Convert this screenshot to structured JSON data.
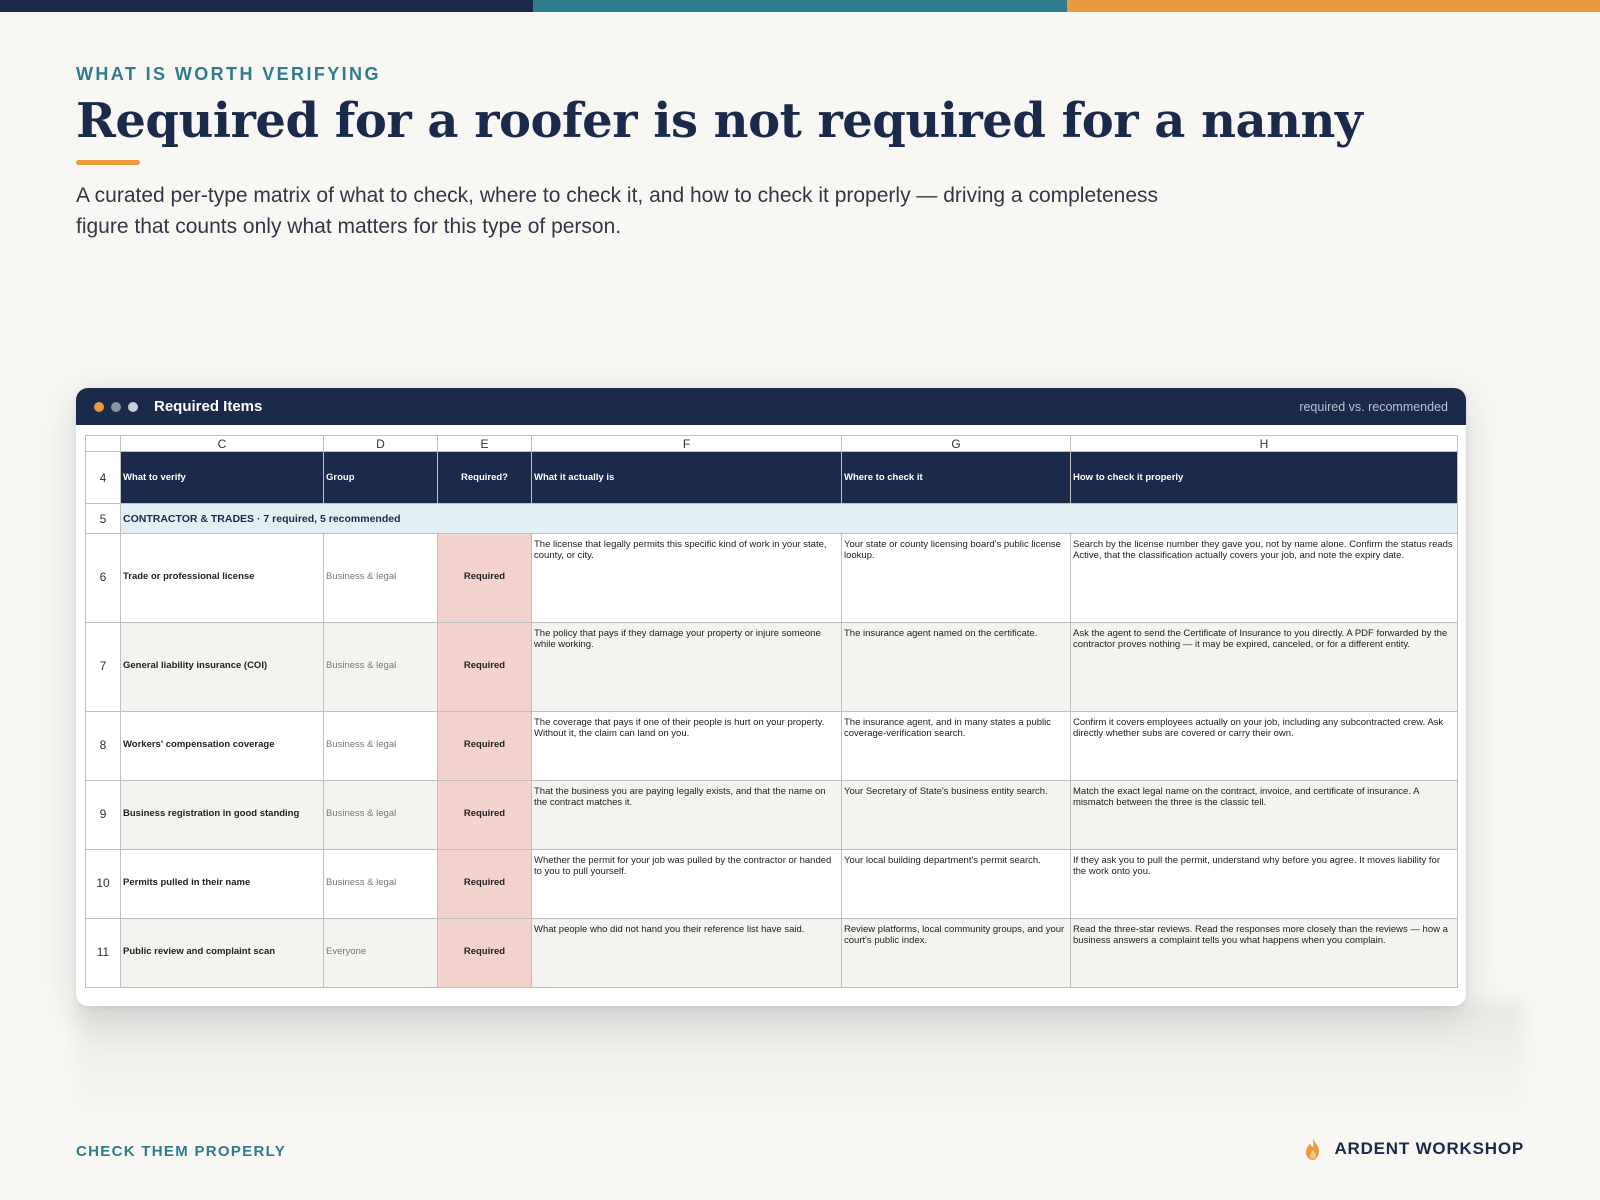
{
  "colors": {
    "navy": "#1b2a4a",
    "teal": "#2e7c8d",
    "orange": "#e99a3d",
    "required_fill": "#f4d3ce",
    "section_fill": "#e3f0f3",
    "alt_row_fill": "#f4f3ef"
  },
  "eyebrow": "WHAT IS WORTH VERIFYING",
  "title": "Required for a roofer is not required for a nanny",
  "subtitle": "A curated per-type matrix of what to check, where to check it, and how to check it properly — driving a completeness figure that counts only what matters for this type of person.",
  "window": {
    "title": "Required Items",
    "tag": "required vs. recommended"
  },
  "sheet": {
    "columns": [
      "C",
      "D",
      "E",
      "F",
      "G",
      "H"
    ],
    "header_row_num": "4",
    "headers": [
      "What to verify",
      "Group",
      "Required?",
      "What it actually is",
      "Where to check it",
      "How to check it properly"
    ],
    "section": {
      "row_num": "5",
      "label": "CONTRACTOR & TRADES  ·  7 required, 5 recommended"
    },
    "rows": [
      {
        "num": "6",
        "item": "Trade or professional license",
        "group": "Business & legal",
        "required": "Required",
        "what": "The license that legally permits this specific kind of work in your state, county, or city.",
        "where": "Your state or county licensing board's public license lookup.",
        "how": "Search by the license number they gave you, not by name alone. Confirm the status reads Active, that the classification actually covers your job, and note the expiry date."
      },
      {
        "num": "7",
        "item": "General liability insurance (COI)",
        "group": "Business & legal",
        "required": "Required",
        "what": "The policy that pays if they damage your property or injure someone while working.",
        "where": "The insurance agent named on the certificate.",
        "how": "Ask the agent to send the Certificate of Insurance to you directly. A PDF forwarded by the contractor proves nothing — it may be expired, canceled, or for a different entity."
      },
      {
        "num": "8",
        "item": "Workers' compensation coverage",
        "group": "Business & legal",
        "required": "Required",
        "what": "The coverage that pays if one of their people is hurt on your property. Without it, the claim can land on you.",
        "where": "The insurance agent, and in many states a public coverage-verification search.",
        "how": "Confirm it covers employees actually on your job, including any subcontracted crew. Ask directly whether subs are covered or carry their own."
      },
      {
        "num": "9",
        "item": "Business registration in good standing",
        "group": "Business & legal",
        "required": "Required",
        "what": "That the business you are paying legally exists, and that the name on the contract matches it.",
        "where": "Your Secretary of State's business entity search.",
        "how": "Match the exact legal name on the contract, invoice, and certificate of insurance. A mismatch between the three is the classic tell."
      },
      {
        "num": "10",
        "item": "Permits pulled in their name",
        "group": "Business & legal",
        "required": "Required",
        "what": "Whether the permit for your job was pulled by the contractor or handed to you to pull yourself.",
        "where": "Your local building department's permit search.",
        "how": "If they ask you to pull the permit, understand why before you agree. It moves liability for the work onto you."
      },
      {
        "num": "11",
        "item": "Public review and complaint scan",
        "group": "Everyone",
        "required": "Required",
        "what": "What people who did not hand you their reference list have said.",
        "where": "Review platforms, local community groups, and your court's public index.",
        "how": "Read the three-star reviews. Read the responses more closely than the reviews — how a business answers a complaint tells you what happens when you complain."
      }
    ]
  },
  "footer": {
    "left": "CHECK THEM PROPERLY",
    "brand": "ARDENT WORKSHOP",
    "brand_icon": "flame-icon"
  }
}
